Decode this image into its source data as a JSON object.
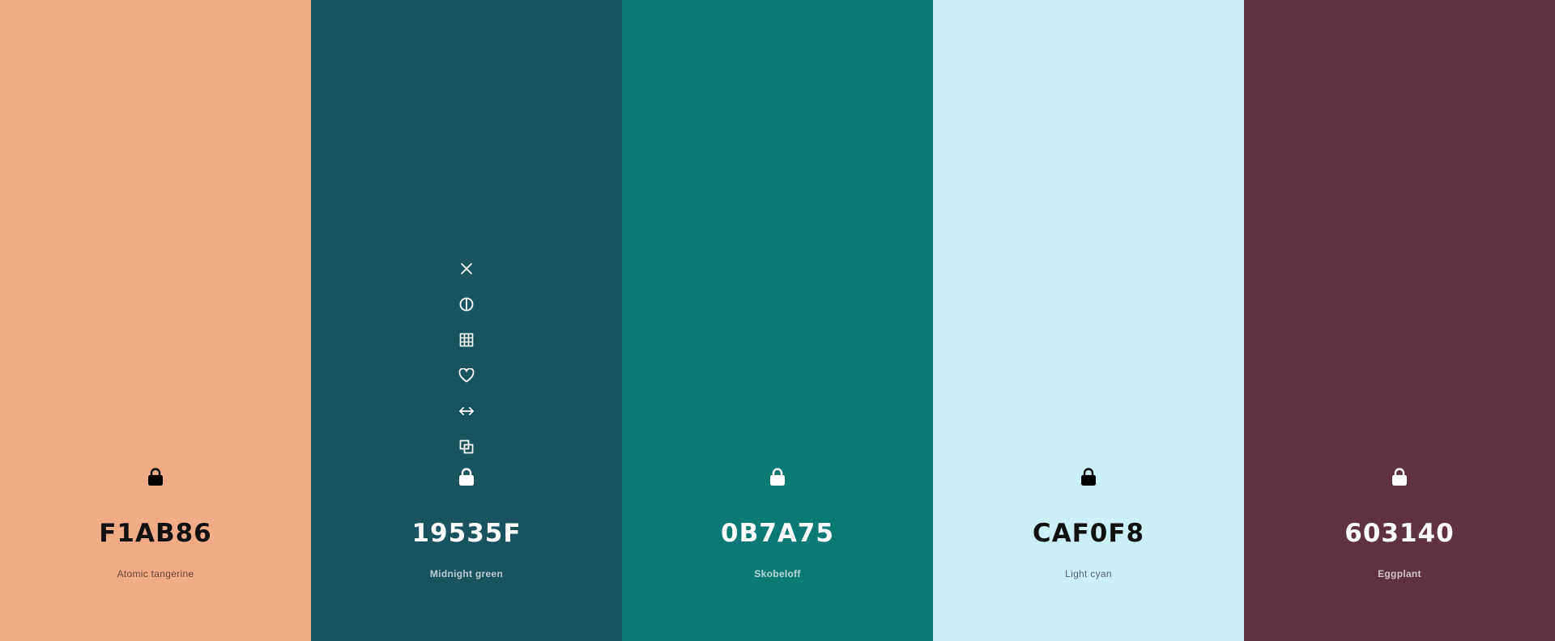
{
  "palette": {
    "colors": [
      {
        "hex": "F1AB86",
        "name": "Atomic tangerine",
        "bg": "#F1AB86",
        "theme": "light"
      },
      {
        "hex": "19535F",
        "name": "Midnight green",
        "bg": "#19535F",
        "theme": "dark"
      },
      {
        "hex": "0B7A75",
        "name": "Skobeloff",
        "bg": "#0B7A75",
        "theme": "dark"
      },
      {
        "hex": "CAF0F8",
        "name": "Light cyan",
        "bg": "#CAF0F8",
        "theme": "light"
      },
      {
        "hex": "603140",
        "name": "Eggplant",
        "bg": "#603140",
        "theme": "dark"
      }
    ],
    "hovered_index": 1,
    "toolbar_icons": [
      "close-icon",
      "contrast-icon",
      "shades-icon",
      "heart-icon",
      "drag-icon",
      "copy-icon"
    ],
    "lock_icon": "lock-icon"
  }
}
